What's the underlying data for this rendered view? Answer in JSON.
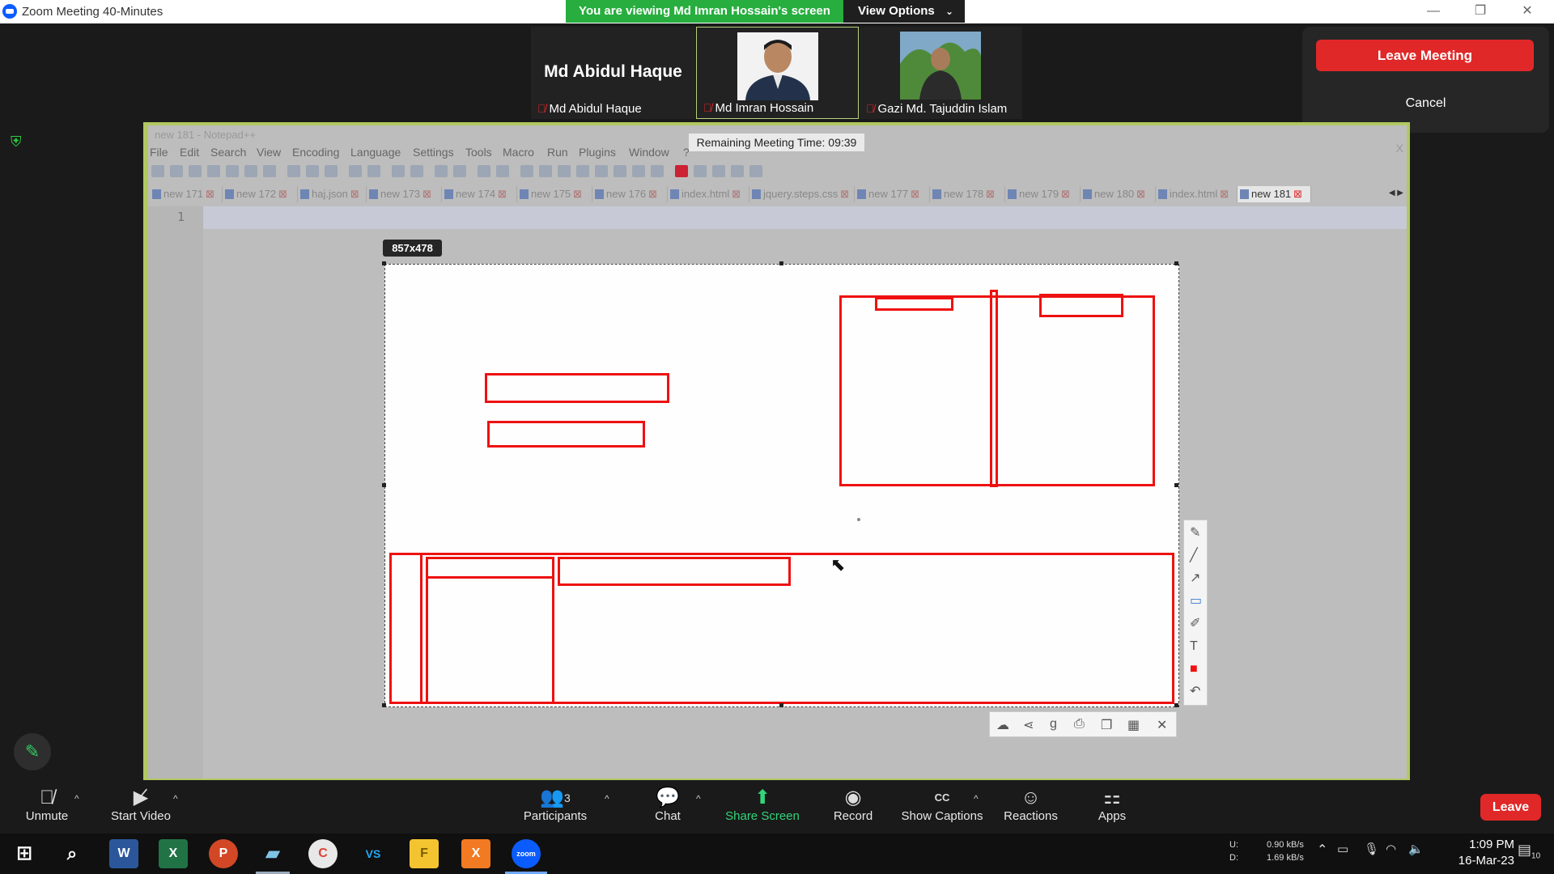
{
  "window": {
    "title": "Zoom Meeting 40-Minutes",
    "minimize": "—",
    "restore": "❐",
    "close": "✕"
  },
  "share_banner": {
    "text": "You are viewing Md Imran Hossain's screen",
    "view_options": "View Options",
    "chevron": "⌄"
  },
  "participants_strip": [
    {
      "display_name": "Md Abidul Haque",
      "name": "Md Abidul Haque",
      "muted": true
    },
    {
      "name": "Md Imran Hossain",
      "muted": true,
      "active": true
    },
    {
      "name": "Gazi Md. Tajuddin Islam",
      "muted": true
    }
  ],
  "leave_popup": {
    "leave_meeting": "Leave Meeting",
    "cancel": "Cancel"
  },
  "shared_app": {
    "title": "new 181 - Notepad++",
    "menu": [
      "File",
      "Edit",
      "Search",
      "View",
      "Encoding",
      "Language",
      "Settings",
      "Tools",
      "Macro",
      "Run",
      "Plugins",
      "Window",
      "?"
    ],
    "tabs": [
      "new 171",
      "new 172",
      "haj.json",
      "new 173",
      "new 174",
      "new 175",
      "new 176",
      "index.html",
      "jquery.steps.css",
      "new 177",
      "new 178",
      "new 179",
      "new 180",
      "index.html",
      "new 181"
    ],
    "active_tab": "new 181",
    "line_number": "1",
    "close": "X"
  },
  "remaining_time": "Remaining Meeting Time: 09:39",
  "snip": {
    "size_label": "857x478"
  },
  "zoom_toolbar": {
    "unmute": "Unmute",
    "start_video": "Start Video",
    "participants": "Participants",
    "participants_count": "3",
    "chat": "Chat",
    "share_screen": "Share Screen",
    "record": "Record",
    "show_captions": "Show Captions",
    "reactions": "Reactions",
    "apps": "Apps",
    "leave": "Leave",
    "caret": "^",
    "cc": "CC"
  },
  "taskbar": {
    "apps": [
      "W",
      "X",
      "P",
      "C",
      "VS",
      "F",
      "X",
      "zoom"
    ],
    "net_up_label": "U:",
    "net_down_label": "D:",
    "net_up": "0.90 kB/s",
    "net_down": "1.69 kB/s",
    "time": "1:09 PM",
    "date": "16-Mar-23",
    "notifications": "10"
  },
  "colors": {
    "accent_green": "#27ae3e",
    "danger_red": "#e02828",
    "annotation_red": "#ee1111"
  }
}
